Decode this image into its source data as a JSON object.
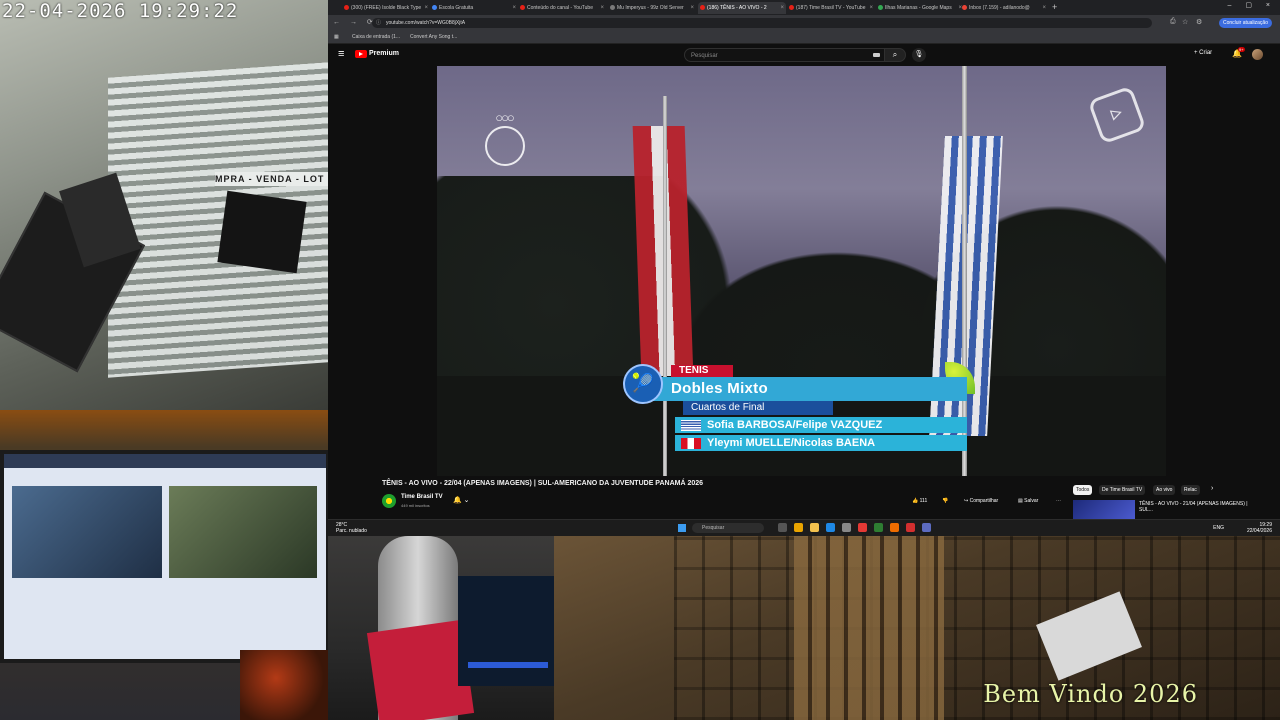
{
  "camera": {
    "timestamp": "22-04-2026  19:29:22",
    "sign_text": "MPRA - VENDA - LOT"
  },
  "overlay": {
    "welcome_text": "Bem Vindo 2026"
  },
  "browser": {
    "tabs": [
      {
        "label": "(300) (FREE) Isolde Black Type",
        "active": false
      },
      {
        "label": "Escola Gratuita",
        "active": false
      },
      {
        "label": "Conteúdo do canal - YouTube",
        "active": false
      },
      {
        "label": "Mu Imperyus - 99z Old Server",
        "active": false
      },
      {
        "label": "(186) TÊNIS - AO VIVO - 2",
        "active": true
      },
      {
        "label": "(187) Time Brasil TV - YouTube",
        "active": false
      },
      {
        "label": "Ilhas Marianas - Google Maps",
        "active": false
      },
      {
        "label": "Inbox (7.159) - adilanodo@",
        "active": false
      }
    ],
    "url": "youtube.com/watch?v=WG0B8jXjtA",
    "update_button": "Concluir atualização",
    "bookmarks": [
      "Caixa de entrada (1...",
      "Convert Any Song t..."
    ]
  },
  "youtube": {
    "brand": "Premium",
    "search_placeholder": "Pesquisar",
    "create_label": "Criar",
    "notifications": "9+",
    "video_title": "TÊNIS - AO VIVO - 22/04 (APENAS IMAGENS) | SUL-AMERICANO DA JUVENTUDE PANAMÁ 2026",
    "channel_name": "Time Brasil TV",
    "channel_subs": "449 mil inscritos",
    "likes": "111",
    "share_label": "Compartilhar",
    "save_label": "Salvar",
    "filters": [
      {
        "label": "Todos",
        "active": true
      },
      {
        "label": "De Time Brasil TV",
        "active": false
      },
      {
        "label": "Ao vivo",
        "active": false
      },
      {
        "label": "Relac",
        "active": false
      }
    ],
    "recommendation": "TÊNIS - AO VIVO - 21/04 (APENAS IMAGENS) | SUL...",
    "lower_third": {
      "sport": "TENIS",
      "event": "Dobles Mixto",
      "round": "Cuartos de Final",
      "team1": "Sofia BARBOSA/Felipe VAZQUEZ",
      "team2": "Yleymi MUELLE/Nicolas BAENA"
    }
  },
  "taskbar": {
    "weather_temp": "28°C",
    "weather_desc": "Parc. nublado",
    "search_label": "Pesquisar",
    "lang": "ENG",
    "time": "19:29",
    "date": "22/04/2026"
  }
}
